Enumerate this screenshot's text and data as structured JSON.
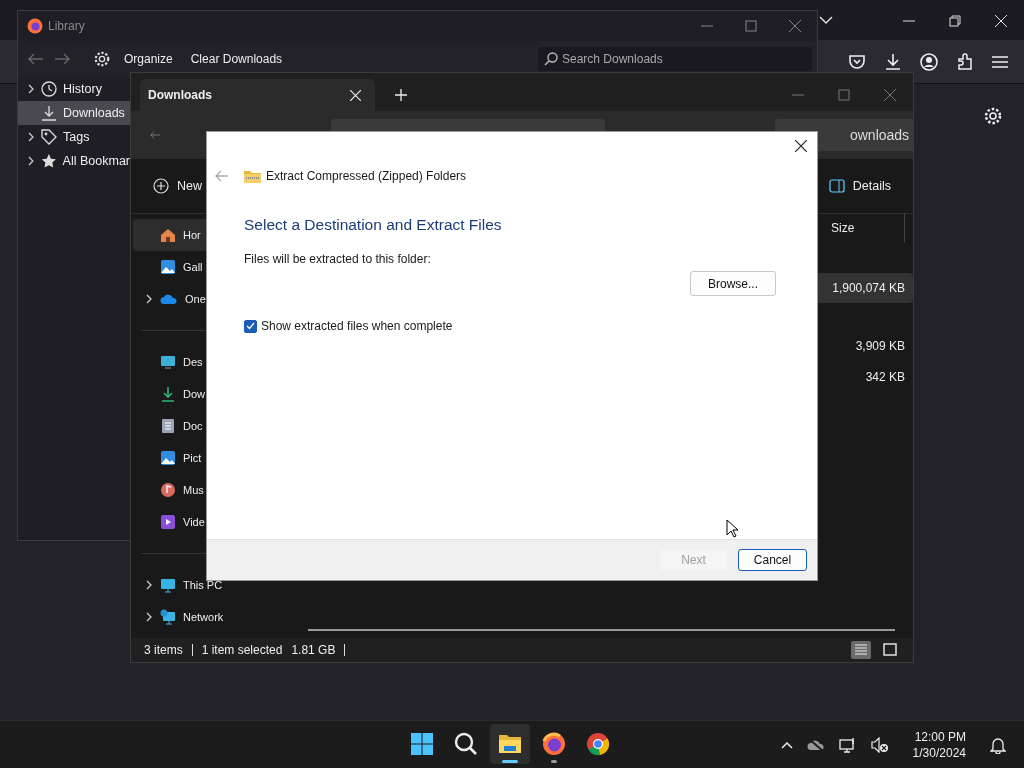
{
  "library": {
    "title": "Library",
    "organize": "Organize",
    "clear": "Clear Downloads",
    "search": {
      "placeholder": "Search Downloads"
    },
    "sidebar": [
      {
        "label": "History",
        "kind": "clock",
        "expandable": true,
        "selected": false
      },
      {
        "label": "Downloads",
        "kind": "download",
        "expandable": false,
        "selected": true
      },
      {
        "label": "Tags",
        "kind": "tag",
        "expandable": true,
        "selected": false
      },
      {
        "label": "All Bookmar",
        "kind": "star",
        "expandable": true,
        "selected": false
      }
    ]
  },
  "explorer": {
    "tab": "Downloads",
    "search_text": "ownloads",
    "new": "New",
    "details": "Details",
    "nav": [
      [
        {
          "label": "Hor",
          "kind": "home",
          "expandable": false,
          "selected": true
        },
        {
          "label": "Gall",
          "kind": "gallery",
          "expandable": false,
          "selected": false
        },
        {
          "label": "One",
          "kind": "cloud",
          "expandable": true,
          "selected": false
        }
      ],
      [
        {
          "label": "Des",
          "kind": "desktop",
          "expandable": false,
          "selected": false
        },
        {
          "label": "Dow",
          "kind": "download",
          "expandable": false,
          "selected": false
        },
        {
          "label": "Doc",
          "kind": "document",
          "expandable": false,
          "selected": false
        },
        {
          "label": "Pict",
          "kind": "pictures",
          "expandable": false,
          "selected": false
        },
        {
          "label": "Mus",
          "kind": "music",
          "expandable": false,
          "selected": false
        },
        {
          "label": "Vide",
          "kind": "video",
          "expandable": false,
          "selected": false
        }
      ],
      [
        {
          "label": "This PC",
          "kind": "pc",
          "expandable": true,
          "selected": false
        },
        {
          "label": "Network",
          "kind": "network",
          "expandable": true,
          "selected": false
        }
      ]
    ],
    "columns": [
      "Size"
    ],
    "rows": [
      {
        "size": "1,900,074 KB",
        "selected": true
      },
      {
        "size": "3,909 KB",
        "selected": false
      },
      {
        "size": "342 KB",
        "selected": false
      }
    ],
    "status": {
      "items": "3 items",
      "selection": "1 item selected",
      "size": "1.81 GB"
    },
    "views": [
      {
        "kind": "details",
        "selected": true
      },
      {
        "kind": "tiles",
        "selected": false
      }
    ]
  },
  "dialog": {
    "title": "Extract Compressed (Zipped) Folders",
    "heading": "Select a Destination and Extract Files",
    "label": "Files will be extracted to this folder:",
    "browse": "Browse...",
    "checkbox": {
      "label": "Show extracted files when complete",
      "checked": true
    },
    "buttons": [
      {
        "label": "Next",
        "disabled": true,
        "default": false
      },
      {
        "label": "Cancel",
        "disabled": false,
        "default": true
      }
    ]
  },
  "taskbar": {
    "apps": [
      {
        "kind": "start",
        "active": false,
        "running": false
      },
      {
        "kind": "search",
        "active": false,
        "running": false
      },
      {
        "kind": "explorer",
        "active": true,
        "running": true
      },
      {
        "kind": "firefox",
        "active": false,
        "running": true
      },
      {
        "kind": "chrome",
        "active": false,
        "running": false
      }
    ],
    "time": "12:00 PM",
    "date": "1/30/2024"
  }
}
